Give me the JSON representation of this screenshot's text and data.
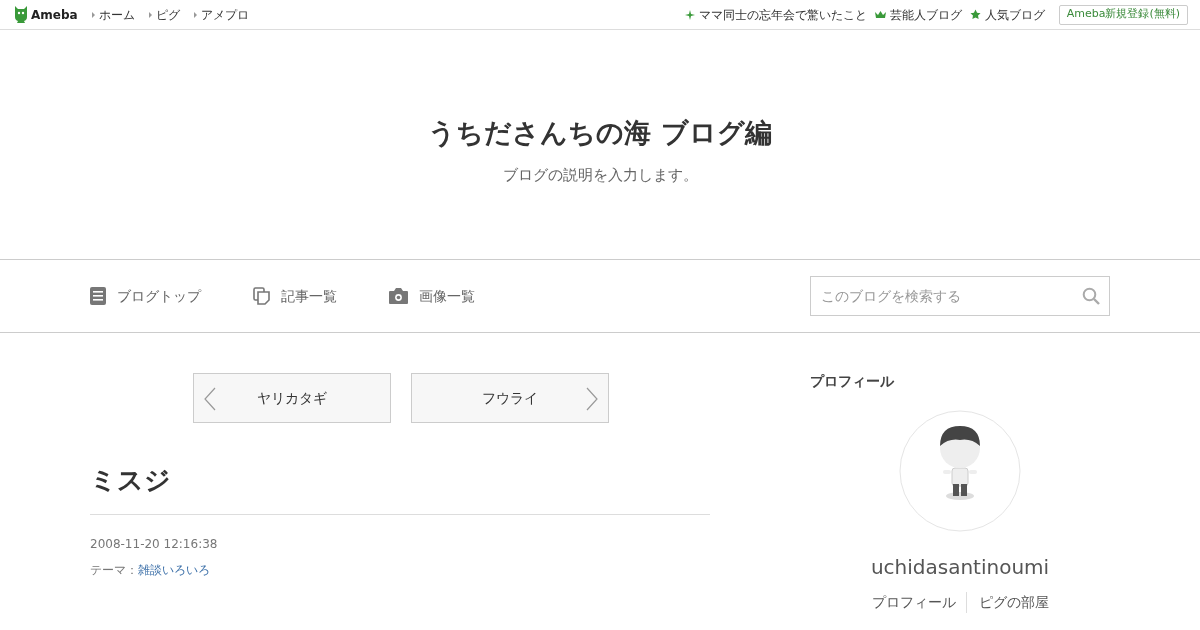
{
  "topbar": {
    "logo": "Ameba",
    "links": [
      "ホーム",
      "ピグ",
      "アメプロ"
    ],
    "right_links": [
      {
        "kind": "sparkle",
        "label": "ママ同士の忘年会で驚いたこと"
      },
      {
        "kind": "crown",
        "label": "芸能人ブログ"
      },
      {
        "kind": "star",
        "label": "人気ブログ"
      }
    ],
    "signup": "Ameba新規登録(無料)"
  },
  "blog": {
    "title": "うちださんちの海 ブログ編",
    "description": "ブログの説明を入力します。"
  },
  "nav": [
    {
      "kind": "doc",
      "label": "ブログトップ"
    },
    {
      "kind": "copy",
      "label": "記事一覧"
    },
    {
      "kind": "camera",
      "label": "画像一覧"
    }
  ],
  "search": {
    "placeholder": "このブログを検索する"
  },
  "pager": {
    "prev": "ヤリカタギ",
    "next": "フウライ"
  },
  "article": {
    "title": "ミスジ",
    "date": "2008-11-20 12:16:38",
    "theme_label": "テーマ：",
    "theme": "雑談いろいろ"
  },
  "profile": {
    "heading": "プロフィール",
    "avatar": {
      "kind": "picture"
    },
    "name": "uchidasantinoumi",
    "links": [
      "プロフィール",
      "ピグの部屋"
    ]
  }
}
